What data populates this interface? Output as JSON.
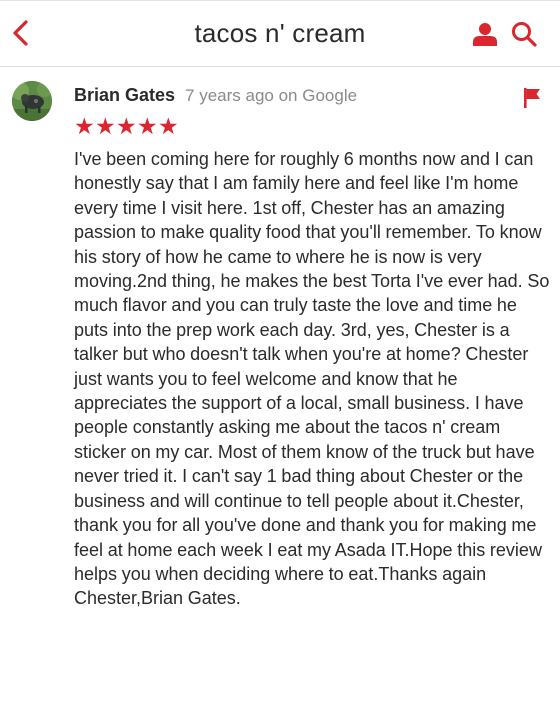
{
  "header": {
    "title": "tacos n' cream",
    "accent": "#d9262f"
  },
  "review": {
    "author": "Brian Gates",
    "time": "7 years ago on Google",
    "rating": 5,
    "stars": "★★★★★",
    "text": "I've been coming here for roughly 6 months now and I can honestly say that I am family here and feel like I'm home every time I visit here. 1st off, Chester has an amazing passion to make quality food that you'll remember. To know his story of how he came to where he is now is very moving.2nd thing, he makes the best Torta I've ever had. So much flavor and you can truly taste the love and time he puts into the prep work each day. 3rd, yes, Chester is a talker but who doesn't talk when you're at home? Chester just wants you to feel welcome and know that he appreciates the support of a local, small business. I have people constantly asking me about the tacos n' cream sticker on my car. Most of them know of the truck but have never tried it. I can't say 1 bad thing about Chester or the business and will continue to tell people about it.Chester, thank you for all you've done and thank you for making me feel at home each week I eat my Asada IT.Hope this review helps you when deciding where to eat.Thanks again Chester,Brian Gates."
  },
  "icons": {
    "back": "chevron-left-icon",
    "account": "person-icon",
    "search": "search-icon",
    "flag": "flag-icon"
  }
}
